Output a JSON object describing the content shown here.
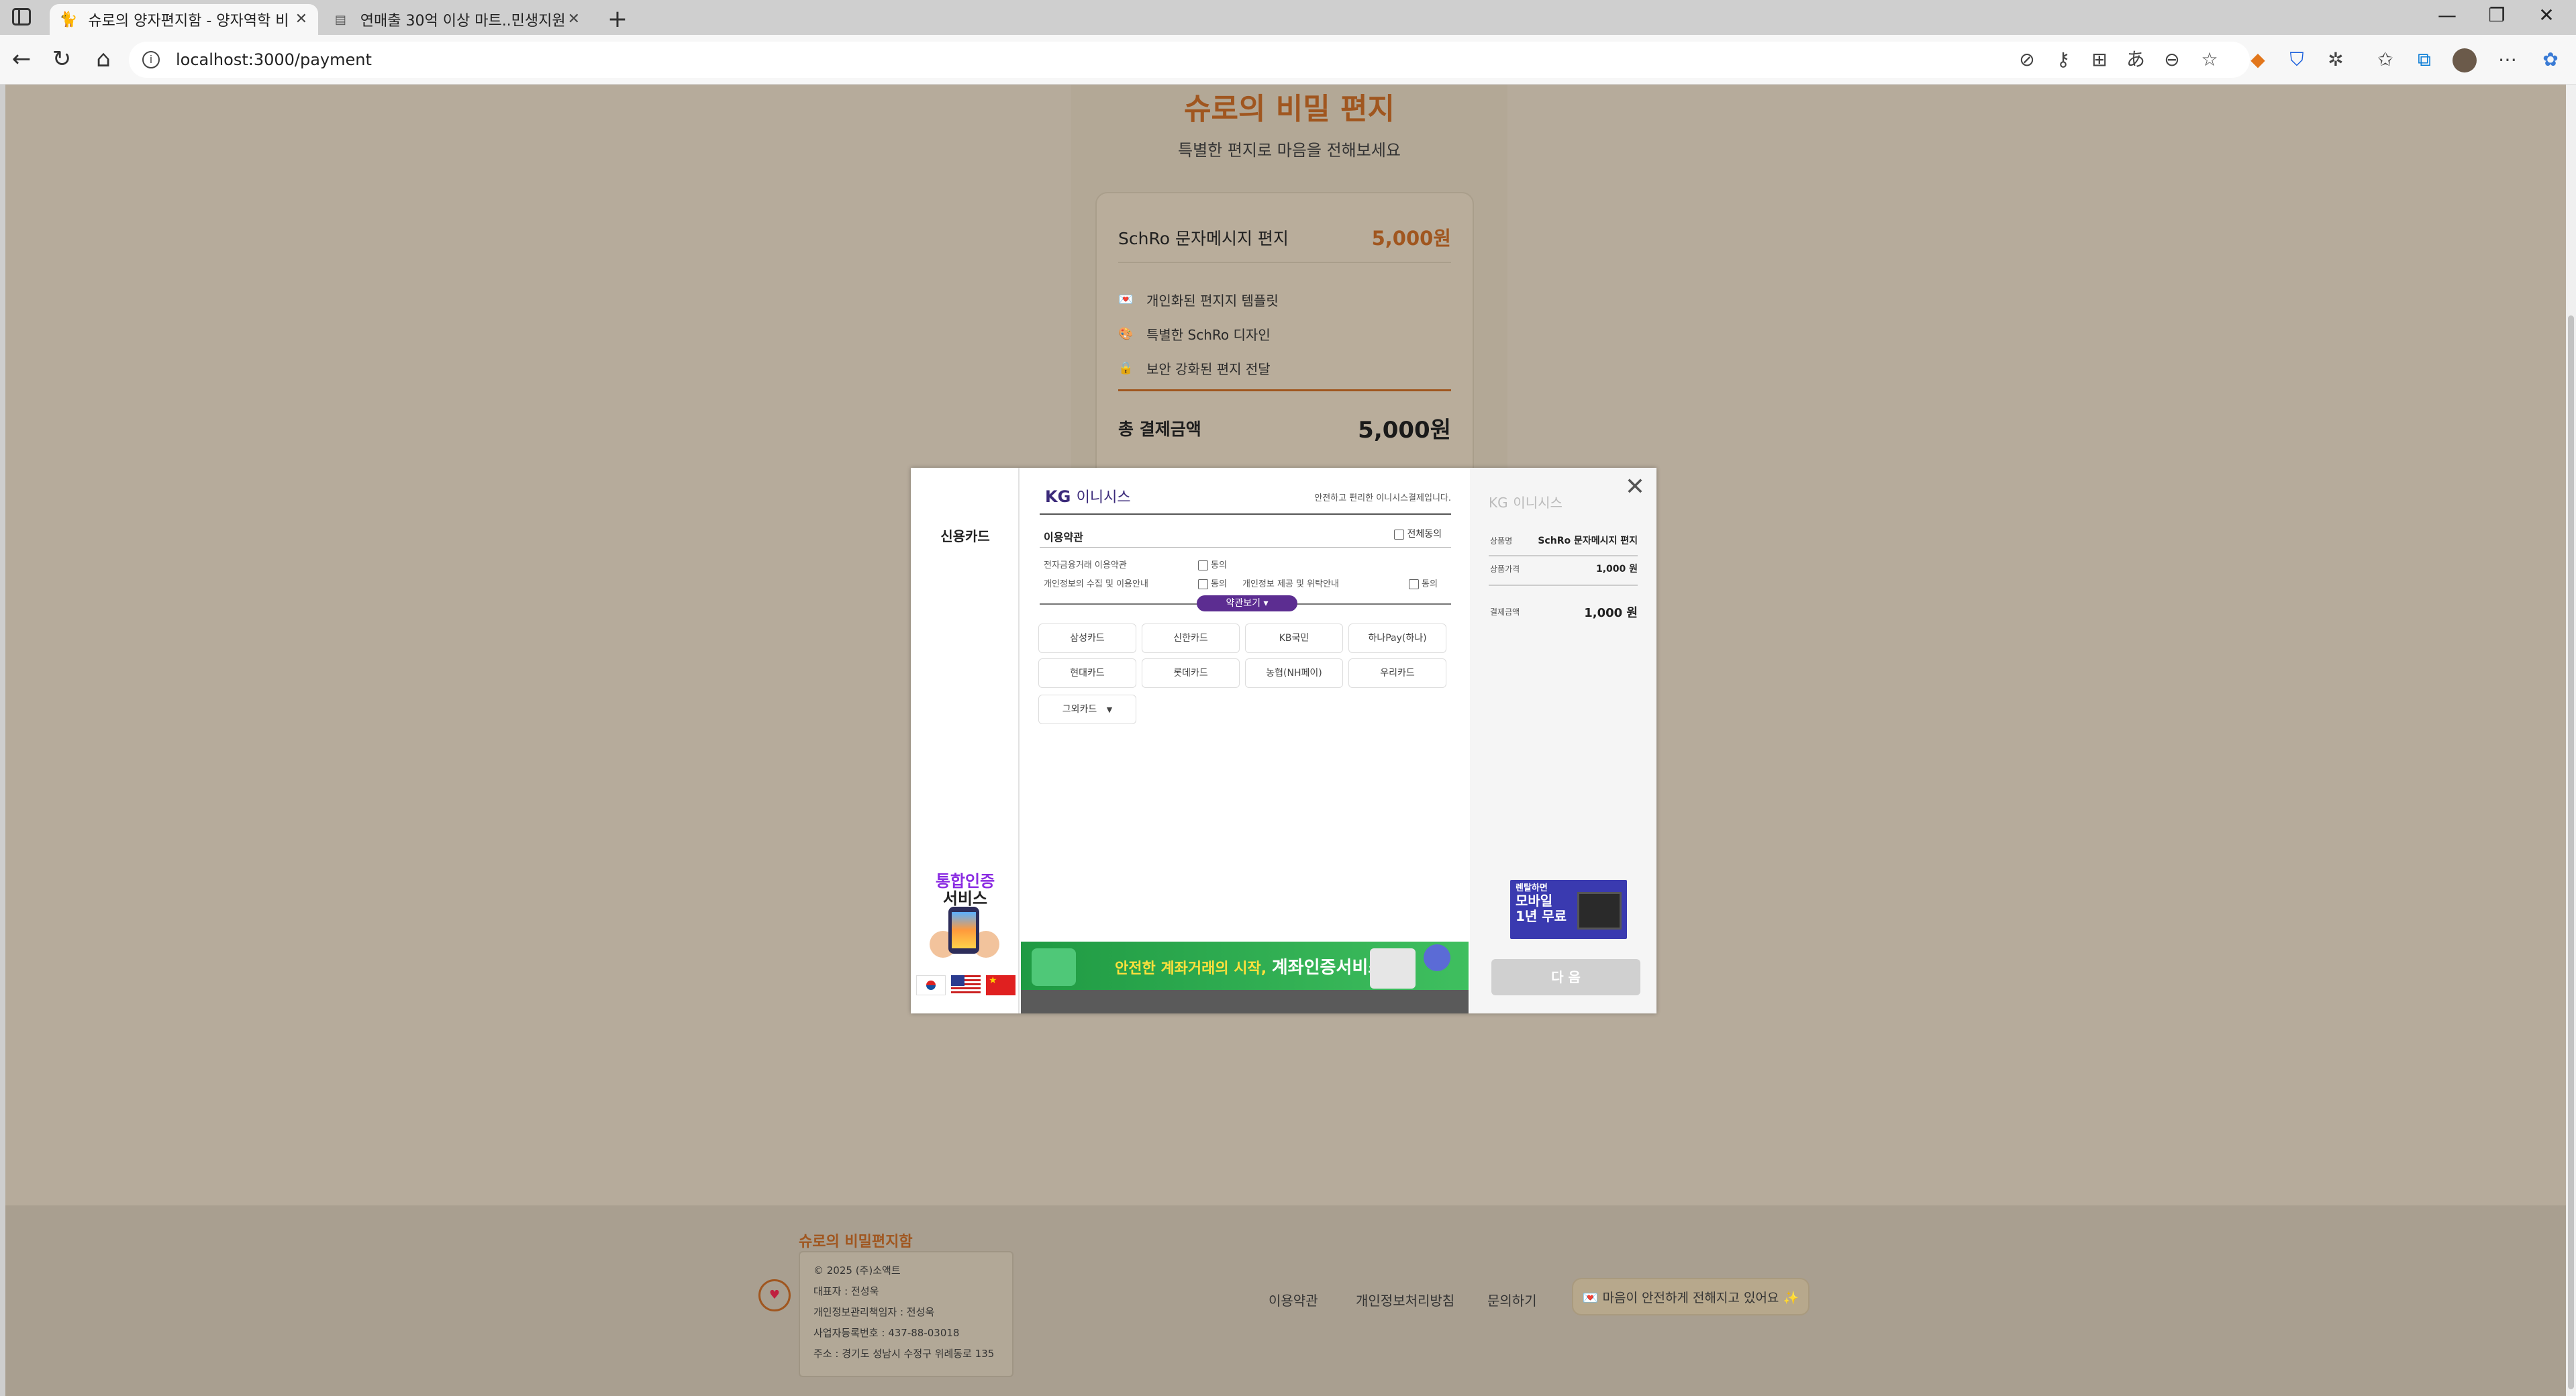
{
  "browser": {
    "tabs": [
      {
        "title": "슈로의 양자편지함 - 양자역학 비",
        "active": true
      },
      {
        "title": "연매출 30억 이상 마트..민생지원",
        "active": false
      }
    ],
    "url": "localhost:3000/payment",
    "new_tab": "+",
    "win_min": "—",
    "win_max": "❐",
    "win_close": "✕",
    "back": "←",
    "reload": "↻",
    "home": "⌂"
  },
  "page": {
    "title": "슈로의 비밀 편지",
    "subtitle": "특별한 편지로 마음을 전해보세요",
    "product_name": "SchRo 문자메시지 편지",
    "product_price": "5,000원",
    "features": [
      {
        "icon": "💌",
        "label": "개인화된 편지지 템플릿"
      },
      {
        "icon": "🎨",
        "label": "특별한 SchRo 디자인"
      },
      {
        "icon": "🔒",
        "label": "보안 강화된 편지 전달"
      }
    ],
    "total_label": "총 결제금액",
    "total_value": "5,000원"
  },
  "footer": {
    "brand": "슈로의 비밀편지함",
    "info": [
      "© 2025 (주)소액트",
      "대표자 : 전성욱",
      "개인정보관리책임자 : 전성욱",
      "사업자등록번호 : 437-88-03018",
      "주소 : 경기도 성남시 수정구 위례동로 135"
    ],
    "links": [
      "이용약관",
      "개인정보처리방침",
      "문의하기"
    ],
    "pill": "💌 마음이 안전하게 전해지고 있어요 ✨"
  },
  "modal": {
    "method": "신용카드",
    "auth_line1": "통합인증",
    "auth_line2": "서비스",
    "logo_kg": "KG",
    "logo_name": "이니시스",
    "safe_text": "안전하고 편리한 이니시스결제입니다.",
    "terms_heading": "이용약관",
    "agree_all": "전체동의",
    "terms": [
      {
        "label": "전자금융거래 이용약관",
        "agree": "동의"
      },
      {
        "label": "개인정보의 수집 및 이용안내",
        "agree": "동의"
      },
      {
        "label": "개인정보 제공 및 위탁안내",
        "agree": "동의"
      }
    ],
    "terms_button": "약관보기 ▾",
    "cards": [
      "삼성카드",
      "신한카드",
      "KB국민",
      "하나Pay(하나)",
      "현대카드",
      "롯데카드",
      "농협(NH페이)",
      "우리카드"
    ],
    "other_cards": "그외카드",
    "banner_text": "안전한 계좌거래의 시작,",
    "banner_bold": "계좌인증서비스",
    "right": {
      "logo_kg": "KG",
      "logo_name": "이니시스",
      "product_label": "상품명",
      "product_value": "SchRo 문자메시지 편지",
      "price_label": "상품가격",
      "price_value": "1,000 원",
      "pay_label": "결제금액",
      "pay_value": "1,000 원",
      "ad_small": "렌탈하면",
      "ad_line1": "모바일",
      "ad_line2": "1년 무료",
      "next": "다 음"
    }
  }
}
